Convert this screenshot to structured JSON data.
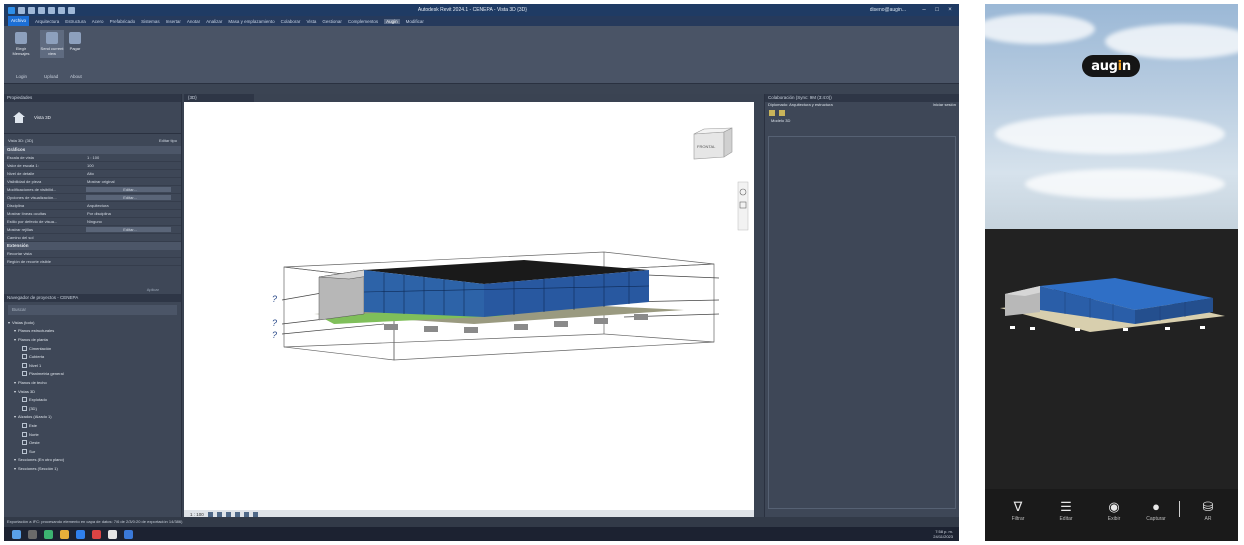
{
  "revit": {
    "title": "Autodesk Revit 2024.1 - CENEPA - Vista 3D {3D}",
    "sign_in": "diseno@augin...",
    "menu": [
      "Archivo",
      "Arquitectura",
      "Estructura",
      "Acero",
      "Prefabricado",
      "Sistemas",
      "Insertar",
      "Anotar",
      "Analizar",
      "Masa y emplazamiento",
      "Colaborar",
      "Vista",
      "Gestionar",
      "Complementos",
      "Augin",
      "Modificar"
    ],
    "ribbon": {
      "buttons": [
        "Elegir Mensajes",
        "Send current view",
        "Pagar"
      ],
      "groups": [
        "Login",
        "Upload",
        "About"
      ]
    },
    "properties": {
      "title": "Propiedades",
      "type_name": "Vista 3D",
      "instance": "Vista 3D: {3D}",
      "edit_type": "Editar tipo",
      "category_graphics": "Gráficos",
      "rows": [
        {
          "k": "Escala de vista",
          "v": "1 : 100",
          "btn": false
        },
        {
          "k": "Valor de escala    1:",
          "v": "100",
          "btn": false
        },
        {
          "k": "Nivel de detalle",
          "v": "Alto",
          "btn": false
        },
        {
          "k": "Visibilidad de pieza",
          "v": "Mostrar original",
          "btn": false
        },
        {
          "k": "Modificaciones de visibilid...",
          "v": "Editar...",
          "btn": true
        },
        {
          "k": "Opciones de visualización...",
          "v": "Editar...",
          "btn": true
        },
        {
          "k": "Disciplina",
          "v": "Arquitectura",
          "btn": false
        },
        {
          "k": "Mostrar líneas ocultas",
          "v": "Por disciplina",
          "btn": false
        },
        {
          "k": "Estilo por defecto de visua...",
          "v": "Ninguno",
          "btn": false
        },
        {
          "k": "Mostrar rejillas",
          "v": "Editar...",
          "btn": true
        },
        {
          "k": "Camino del sol",
          "v": "",
          "btn": false
        }
      ],
      "category_extents": "Extensión",
      "rows2": [
        {
          "k": "Recortar vista",
          "v": ""
        },
        {
          "k": "Región de recorte visible",
          "v": ""
        }
      ],
      "apply": "Aplicar"
    },
    "browser": {
      "title": "Navegador de proyectos - CENEPA",
      "search": "Buscar",
      "items": [
        {
          "text": "Vistas (todo)",
          "indent": 4,
          "box": false
        },
        {
          "text": "Planos estructurales",
          "indent": 10,
          "box": false
        },
        {
          "text": "Planos de planta",
          "indent": 10,
          "box": false
        },
        {
          "text": "Cimentación",
          "indent": 18,
          "box": true
        },
        {
          "text": "Cubierta",
          "indent": 18,
          "box": true
        },
        {
          "text": "Nivel 1",
          "indent": 18,
          "box": true
        },
        {
          "text": "Planimetría general",
          "indent": 18,
          "box": true
        },
        {
          "text": "Planos de techo",
          "indent": 10,
          "box": false
        },
        {
          "text": "Vistas 3D",
          "indent": 10,
          "box": false
        },
        {
          "text": "Explotado",
          "indent": 18,
          "box": true
        },
        {
          "text": "{3D}",
          "indent": 18,
          "box": true
        },
        {
          "text": "Alzados (Alzado 1)",
          "indent": 10,
          "box": false
        },
        {
          "text": "Este",
          "indent": 18,
          "box": true
        },
        {
          "text": "Norte",
          "indent": 18,
          "box": true
        },
        {
          "text": "Oeste",
          "indent": 18,
          "box": true
        },
        {
          "text": "Sur",
          "indent": 18,
          "box": true
        },
        {
          "text": "Secciones (En otro plano)",
          "indent": 10,
          "box": false
        },
        {
          "text": "Secciones (Sección 1)",
          "indent": 10,
          "box": false
        }
      ]
    },
    "view_tab": "{3D}",
    "viewcube_label": "FRONTAL",
    "level_marks": [
      "?",
      "?",
      "?"
    ],
    "view_scale": "1 : 100",
    "collab": {
      "title": "Colaboración (Sync: 9M (3:4:0))",
      "subtitle": "Diplomado: Arquitectura y estructura",
      "action": "Iniciar sesión",
      "tree_item": "Modelo 3D"
    },
    "status": "Exportación a IFC: procesando elemento en capa de datos: 7/6 de 2/3/0:20 de exportación 14/386)",
    "clock": [
      "7:58 p. m.",
      "24/11/2023"
    ]
  },
  "phone": {
    "logo_text": "aug",
    "logo_accent": "i",
    "logo_end": "n",
    "toolbar": [
      {
        "icon": "filter-icon",
        "glyph": "∇",
        "label": "Filtrar"
      },
      {
        "icon": "sliders-icon",
        "glyph": "☰",
        "label": "Editar"
      },
      {
        "icon": "eye-icon",
        "glyph": "◉",
        "label": "Exibir"
      },
      {
        "icon": "camera-icon",
        "glyph": "●",
        "label": "Capturar"
      },
      {
        "icon": "ar-icon",
        "glyph": "⛁",
        "label": "AR"
      }
    ]
  },
  "colors": {
    "revit_chrome": "#3b4453",
    "roof_blue": "#2c6fc4",
    "augin_orange": "#f7a21b"
  }
}
